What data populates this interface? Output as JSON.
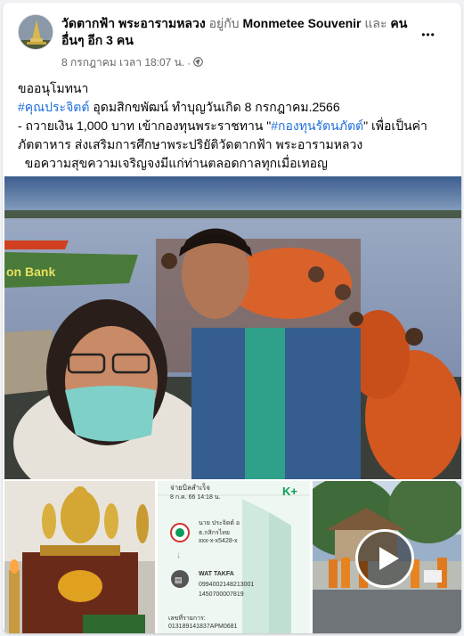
{
  "post": {
    "page_name": "วัดตากฟ้า พระอารามหลวง",
    "with_text": "อยู่กับ",
    "tagged": "Monmetee Souvenir",
    "and_text": "และ",
    "others": "คนอื่นๆ อีก 3 คน",
    "timestamp": "8 กรกฎาคม เวลา 18:07 น.",
    "separator": "·",
    "privacy_icon": "globe-icon",
    "more_icon": "more-dots-icon",
    "more_label": "•••"
  },
  "message": {
    "line1": "ขออนุโมทนา",
    "hashtag1": "#คุณประจิตต์",
    "line2_rest": " อุดมสิกขพัฒน์ ทำบุญวันเกิด 8 กรกฎาคม.2566",
    "line3_start": "- ถวายเงิน 1,000 บาท เข้ากองทุนพระราชทาน \"",
    "hashtag2": "#กองทุนรัตนภัตต์",
    "line3_end": "\" เพื่อเป็นค่า",
    "line4": "ภัตตาหาร ส่งเสริมการศึกษาพระปริยัติวัดตากฟ้า พระอารามหลวง",
    "line5": "  ขอความสุขความเจริญจงมีแก่ท่านตลอดกาลทุกเมื่อเทอญ"
  },
  "photos": {
    "boat_text": "on Bank",
    "slip": {
      "title": "จ่ายบิลสำเร็จ",
      "date": "8 ก.ค. 66  14:18 น.",
      "brand": "K+",
      "from_name": "นาย ประจิตต์ อ",
      "from_bank": "ธ.กสิกรไทย",
      "from_acct": "xxx-x-x5428-x",
      "to_name": "WAT TAKFA",
      "to_ref1": "0994002148213001",
      "to_ref2": "1450700007819",
      "ref_label": "เลขที่รายการ:",
      "ref_value": "013189141837APM0681"
    },
    "video_icon": "play-icon"
  },
  "colors": {
    "hashtag": "#216fdb",
    "muted": "#65676b",
    "kplus_green": "#0b9d58"
  }
}
